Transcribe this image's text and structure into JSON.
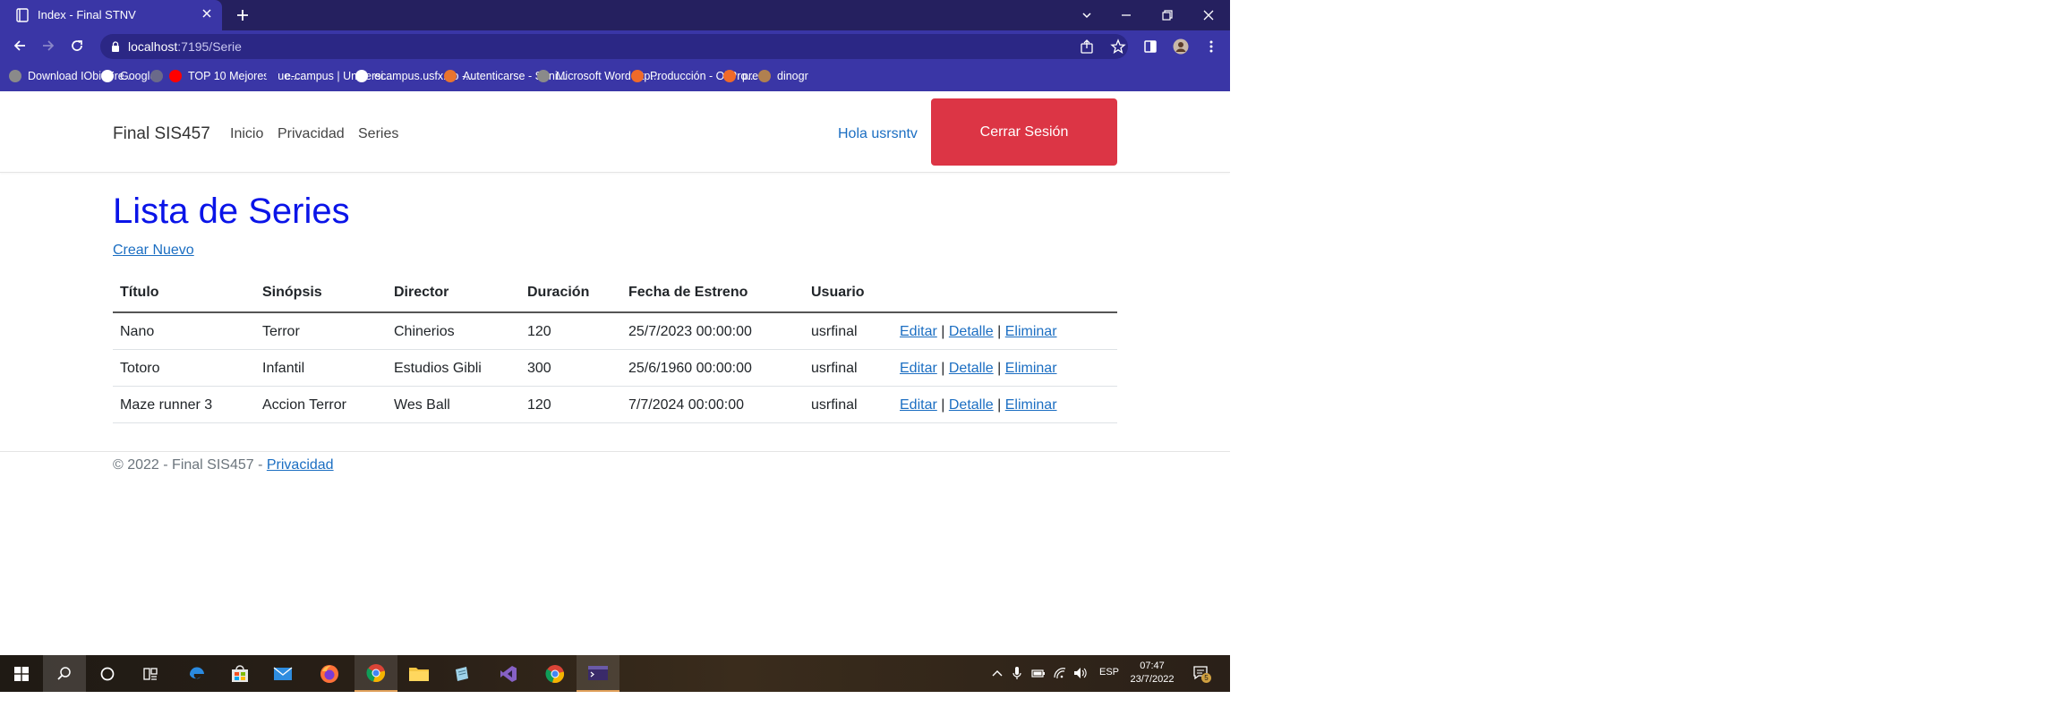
{
  "browser": {
    "tab_title": "Index - Final STNV",
    "url_host": "localhost",
    "url_rest": ":7195/Serie",
    "bookmarks": [
      {
        "label": "Download IObit Fre...",
        "icon": "iobit-icon",
        "color": "#8a8a8a"
      },
      {
        "label": "Google",
        "icon": "google-icon",
        "color": "#ffffff"
      },
      {
        "label": "",
        "icon": "globe-icon",
        "color": "#6a6a8a"
      },
      {
        "label": "TOP 10 Mejores Jue...",
        "icon": "youtube-icon",
        "color": "#ff0000"
      },
      {
        "label": "e-campus | Universi...",
        "icon": "ecampus-icon",
        "color": "#3a36a6"
      },
      {
        "label": "ecampus.usfx.bo -...",
        "icon": "google-icon",
        "color": "#ffffff"
      },
      {
        "label": "Autenticarse - Suni...",
        "icon": "sunimoodle-icon",
        "color": "#e8742f"
      },
      {
        "label": "Microsoft Word - tp...",
        "icon": "globe-icon",
        "color": "#8a8a8a"
      },
      {
        "label": "Producción - OilPro...",
        "icon": "oilpro-icon",
        "color": "#ef6a2a"
      },
      {
        "label": "pre",
        "icon": "pre-icon",
        "color": "#ef6a2a"
      },
      {
        "label": "dinogr",
        "icon": "dinogr-icon",
        "color": "#b08050"
      }
    ]
  },
  "navbar": {
    "brand": "Final SIS457",
    "links": [
      "Inicio",
      "Privacidad",
      "Series"
    ],
    "greeting": "Hola usrsntv",
    "logout": "Cerrar Sesión"
  },
  "page": {
    "title": "Lista de Series",
    "create_link": "Crear Nuevo"
  },
  "table": {
    "headers": [
      "Título",
      "Sinópsis",
      "Director",
      "Duración",
      "Fecha de Estreno",
      "Usuario"
    ],
    "rows": [
      [
        "Nano",
        "Terror",
        "Chinerios",
        "120",
        "25/7/2023 00:00:00",
        "usrfinal"
      ],
      [
        "Totoro",
        "Infantil",
        "Estudios Gibli",
        "300",
        "25/6/1960 00:00:00",
        "usrfinal"
      ],
      [
        "Maze runner 3",
        "Accion Terror",
        "Wes Ball",
        "120",
        "7/7/2024 00:00:00",
        "usrfinal"
      ]
    ],
    "actions": {
      "edit": "Editar",
      "detail": "Detalle",
      "delete": "Eliminar",
      "separator": "|"
    }
  },
  "footer": {
    "text": "© 2022 - Final SIS457 - ",
    "link": "Privacidad"
  },
  "taskbar": {
    "lang": "ESP",
    "time": "07:47",
    "date": "23/7/2022",
    "notifications": "5"
  },
  "colors": {
    "title_blue": "#0a14e8",
    "link_blue": "#1b6ec2",
    "danger": "#dc3545",
    "chrome_dark": "#25205f",
    "chrome": "#3a36a6"
  }
}
